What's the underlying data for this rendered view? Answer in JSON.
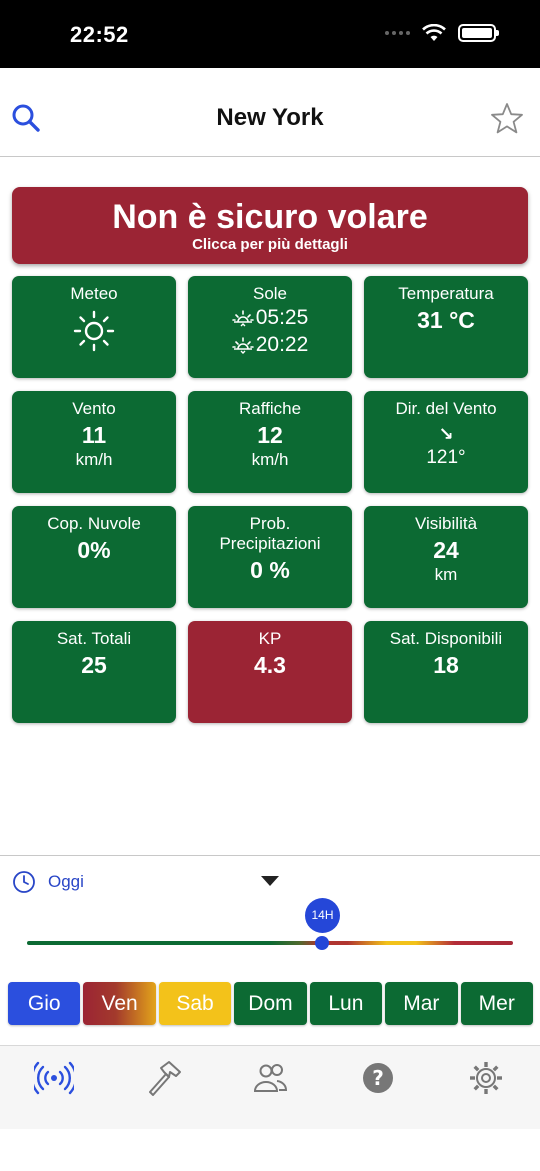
{
  "status_bar": {
    "time": "22:52"
  },
  "nav": {
    "title": "New York"
  },
  "alert": {
    "title": "Non è sicuro volare",
    "subtitle": "Clicca per più dettagli",
    "color": "#9b2434"
  },
  "tiles": {
    "meteo": {
      "label": "Meteo",
      "icon": "sun-icon"
    },
    "sole": {
      "label": "Sole",
      "sunrise": "05:25",
      "sunset": "20:22"
    },
    "temperatura": {
      "label": "Temperatura",
      "value": "31 °C"
    },
    "vento": {
      "label": "Vento",
      "value": "11",
      "unit": "km/h"
    },
    "raffiche": {
      "label": "Raffiche",
      "value": "12",
      "unit": "km/h"
    },
    "dir_vento": {
      "label": "Dir. del Vento",
      "arrow": "↘",
      "value": "121°"
    },
    "cop_nuvole": {
      "label": "Cop. Nuvole",
      "value": "0%"
    },
    "prob_precip": {
      "label": "Prob. Precipitazioni",
      "value": "0 %"
    },
    "visibilita": {
      "label": "Visibilità",
      "value": "24",
      "unit": "km"
    },
    "sat_totali": {
      "label": "Sat. Totali",
      "value": "25"
    },
    "kp": {
      "label": "KP",
      "value": "4.3"
    },
    "sat_disponibili": {
      "label": "Sat. Disponibili",
      "value": "18"
    }
  },
  "colors": {
    "safe": "#0c6a33",
    "unsafe": "#9b2434",
    "warning": "#f3c21a",
    "accent": "#2b4fde"
  },
  "time_selector": {
    "label": "Oggi",
    "slider_value": "14H",
    "slider_position": 0.6
  },
  "days": [
    {
      "label": "Gio",
      "state": "selected"
    },
    {
      "label": "Ven",
      "state": "mixed"
    },
    {
      "label": "Sab",
      "state": "warning"
    },
    {
      "label": "Dom",
      "state": "safe"
    },
    {
      "label": "Lun",
      "state": "safe"
    },
    {
      "label": "Mar",
      "state": "safe"
    },
    {
      "label": "Mer",
      "state": "safe"
    }
  ],
  "tab_bar": [
    {
      "icon": "signal-broadcast-icon",
      "active": true
    },
    {
      "icon": "hammer-icon",
      "active": false
    },
    {
      "icon": "people-icon",
      "active": false
    },
    {
      "icon": "help-icon",
      "active": false
    },
    {
      "icon": "settings-gear-icon",
      "active": false
    }
  ]
}
